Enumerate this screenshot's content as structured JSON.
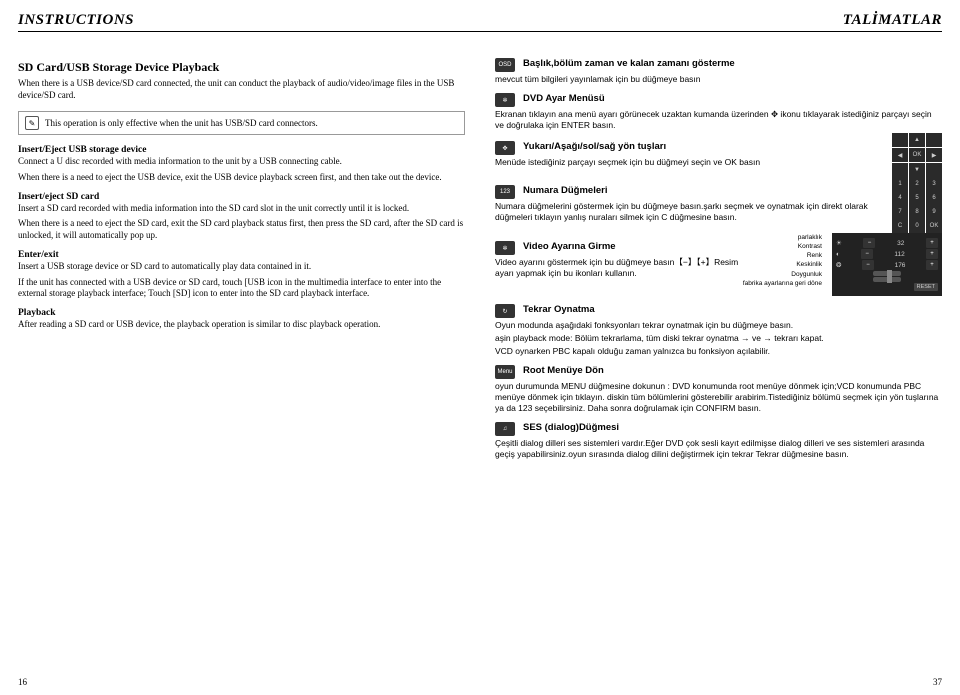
{
  "header": {
    "left": "INSTRUCTIONS",
    "right": "TALİMATLAR"
  },
  "left": {
    "title": "SD Card/USB Storage Device Playback",
    "intro": "When there is a USB device/SD card connected, the unit can conduct the playback of audio/video/image files in the USB device/SD card.",
    "note": "This operation is only effective when the unit has USB/SD card connectors.",
    "s1_title": "Insert/Eject USB storage device",
    "s1_p1": "Connect a U disc recorded with media information to the unit by a USB connecting cable.",
    "s1_p2": "When there is a need to eject the USB device, exit the USB device playback screen first, and then take out the device.",
    "s2_title": "Insert/eject SD card",
    "s2_p1": "Insert a SD card recorded with media information into the SD card slot in the unit correctly until it is locked.",
    "s2_p2": "When there is a need to eject the SD card, exit the SD card playback status first, then press the SD card, after the SD card is unlocked, it will automatically pop up.",
    "s3_title": "Enter/exit",
    "s3_p1": "Insert a USB storage device or SD card to automatically play data contained in it.",
    "s3_p2": "If the unit has connected with a USB device or SD card, touch [USB   icon in the multimedia interface to enter into the external storage playback interface; Touch [SD]   icon to enter into the SD card playback interface.",
    "s4_title": "Playback",
    "s4_p1": "After reading a SD card or USB device, the playback operation is similar to disc playback operation."
  },
  "right": {
    "osd_badge": "OSD",
    "osd_title": "Başlık,bölüm zaman ve kalan zamanı gösterme",
    "osd_p": "mevcut tüm bilgileri yayınlamak için bu düğmeye basın",
    "dvd_title": "DVD Ayar Menüsü",
    "dvd_p": "Ekranan tıklayın  ana menü ayarı görünecek uzaktan kumanda üzerinden ✥ ikonu tıklayarak istediğiniz parçayı seçin ve doğrulaka için ENTER basın.",
    "dir_title": "Yukarı/Aşağı/sol/sağ yön tuşları",
    "dir_p": "Menüde istediğiniz parçayı seçmek için bu düğmeyi  seçin ve OK basın",
    "num_title": "Numara Düğmeleri",
    "num_p": "Numara düğmelerini göstermek için bu düğmeye basın.şarkı seçmek ve oynatmak için direkt olarak düğmeleri tıklayın yanlış nuraları silmek için C düğmesine basın.",
    "vid_title": "Video Ayarına Girme",
    "vid_p": "Video ayarını göstermek için bu düğmeye basın【−】【+】Resim ayarı yapmak için bu ikonları kullanın.",
    "vid_panel": {
      "brightness": "parlaklık",
      "contrast": "Kontrast",
      "color": "Renk",
      "sharpness": "Keskinlik",
      "saturation": "Doygunluk",
      "reset_label": "fabrika ayarlarına geri döne",
      "reset_btn": "RESET",
      "v1": "32",
      "v2": "112",
      "v3": "176"
    },
    "rep_title": "Tekrar Oynatma",
    "rep_p1": "Oyun modunda aşağıdaki fonksyonları tekrar oynatmak için bu düğmeye basın.",
    "rep_p2": "aşin playback mode: Bölüm tekrarlama, tüm diski tekrar oynatma → ve → tekrarı kapat.",
    "rep_p3": "VCD oynarken PBC kapalı olduğu zaman yalnızca  bu fonksiyon  açılabilir.",
    "root_badge": "Menu",
    "root_title": "Root Menüye Dön",
    "root_p": "oyun durumunda MENU düğmesine dokunun : DVD konumunda root menüye dönmek için;VCD konumunda PBC menüye dönmek için tıklayın. diskin tüm bölümlerini gösterebilir arabirim.Tistediğiniz bölümü seçmek için yön tuşlarına ya da 123 seçebilirsiniz. Daha sonra doğrulamak için CONFIRM basın.",
    "ses_title": "SES (dialog)Düğmesi",
    "ses_p": "Çeşitli dialog dilleri ses sistemleri vardır.Eğer DVD çok sesli kayıt edilmişse dialog dilleri ve ses sistemleri arasında geçiş yapabilirsiniz.oyun sırasında dialog dilini değiştirmek için tekrar Tekrar düğmesine basın."
  },
  "footer": {
    "left": "16",
    "right": "37"
  }
}
